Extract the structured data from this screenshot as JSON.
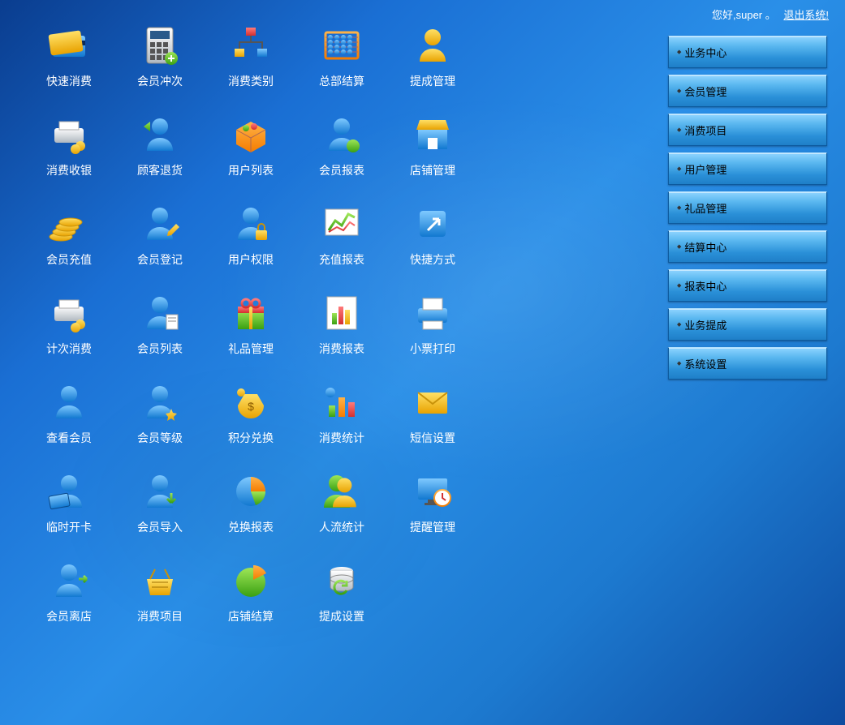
{
  "header": {
    "greeting": "您好,super 。",
    "logout": "退出系统!"
  },
  "sidebar": {
    "items": [
      {
        "label": "业务中心"
      },
      {
        "label": "会员管理"
      },
      {
        "label": "消费项目"
      },
      {
        "label": "用户管理"
      },
      {
        "label": "礼品管理"
      },
      {
        "label": "结算中心"
      },
      {
        "label": "报表中心"
      },
      {
        "label": "业务提成"
      },
      {
        "label": "系统设置"
      }
    ]
  },
  "grid": {
    "cells": [
      {
        "label": "快速消费",
        "icon": "credit-card"
      },
      {
        "label": "会员冲次",
        "icon": "calculator"
      },
      {
        "label": "消费类别",
        "icon": "org-chart"
      },
      {
        "label": "总部结算",
        "icon": "abacus"
      },
      {
        "label": "提成管理",
        "icon": "user-gold"
      },
      {
        "label": "消费收银",
        "icon": "printer-coins"
      },
      {
        "label": "顾客退货",
        "icon": "user-back"
      },
      {
        "label": "用户列表",
        "icon": "box-goods"
      },
      {
        "label": "会员报表",
        "icon": "user-green"
      },
      {
        "label": "店铺管理",
        "icon": "store"
      },
      {
        "label": "会员充值",
        "icon": "coins"
      },
      {
        "label": "会员登记",
        "icon": "user-pencil"
      },
      {
        "label": "用户权限",
        "icon": "user-lock"
      },
      {
        "label": "充值报表",
        "icon": "trend-chart"
      },
      {
        "label": "快捷方式",
        "icon": "shortcut"
      },
      {
        "label": "计次消费",
        "icon": "printer-coins"
      },
      {
        "label": "会员列表",
        "icon": "user-list"
      },
      {
        "label": "礼品管理",
        "icon": "gift"
      },
      {
        "label": "消费报表",
        "icon": "bar-doc"
      },
      {
        "label": "小票打印",
        "icon": "printer"
      },
      {
        "label": "查看会员",
        "icon": "user-view"
      },
      {
        "label": "会员等级",
        "icon": "user-star"
      },
      {
        "label": "积分兑换",
        "icon": "money-bag"
      },
      {
        "label": "消费统计",
        "icon": "bar-stats"
      },
      {
        "label": "短信设置",
        "icon": "envelope"
      },
      {
        "label": "临时开卡",
        "icon": "card-user"
      },
      {
        "label": "会员导入",
        "icon": "user-import"
      },
      {
        "label": "兑换报表",
        "icon": "pie-chart"
      },
      {
        "label": "人流统计",
        "icon": "users"
      },
      {
        "label": "提醒管理",
        "icon": "monitor-clock"
      },
      {
        "label": "会员离店",
        "icon": "user-leave"
      },
      {
        "label": "消费项目",
        "icon": "basket"
      },
      {
        "label": "店铺结算",
        "icon": "pie-green"
      },
      {
        "label": "提成设置",
        "icon": "db-sync"
      }
    ]
  }
}
